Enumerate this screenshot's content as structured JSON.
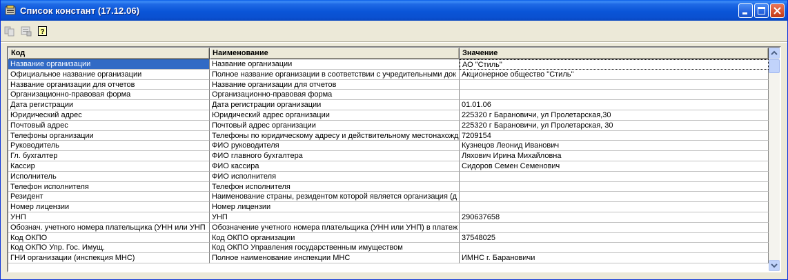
{
  "window": {
    "title": "Список констант (17.12.06)"
  },
  "colors": {
    "title_bar": "#0a55d8",
    "selection": "#316ac5",
    "window_bg": "#ece9d8"
  },
  "toolbar": {
    "icons": [
      "copy-icon",
      "properties-icon",
      "help-icon"
    ]
  },
  "grid": {
    "columns": [
      "Код",
      "Наименование",
      "Значение"
    ],
    "rows": [
      {
        "code": "Название организации",
        "name": "Название организации",
        "value": " АО \"Стиль\""
      },
      {
        "code": "Официальное название организации",
        "name": "Полное название организации в соответствии с учредительными док",
        "value": "Акционерное общество \"Стиль\""
      },
      {
        "code": "Название организации для отчетов",
        "name": "Название организации для отчетов",
        "value": ""
      },
      {
        "code": "Организационно-правовая форма",
        "name": "Организационно-правовая форма",
        "value": ""
      },
      {
        "code": "Дата регистрации",
        "name": "Дата регистрации организации",
        "value": "01.01.06"
      },
      {
        "code": "Юридический адрес",
        "name": "Юридический адрес организации",
        "value": "225320 г Барановичи, ул Пролетарская,30"
      },
      {
        "code": "Почтовый адрес",
        "name": "Почтовый адрес организации",
        "value": "225320 г Барановичи, ул Пролетарская, 30"
      },
      {
        "code": "Телефоны организации",
        "name": "Телефоны по юридическому адресу и действительному местонахожд",
        "value": "7209154"
      },
      {
        "code": "Руководитель",
        "name": "ФИО руководителя",
        "value": "Кузнецов Леонид Иванович"
      },
      {
        "code": "Гл. бухгалтер",
        "name": "ФИО главного бухгалтера",
        "value": "Ляхович Ирина Михайловна"
      },
      {
        "code": "Кассир",
        "name": "ФИО кассира",
        "value": "Сидоров Семен Семенович"
      },
      {
        "code": "Исполнитель",
        "name": "ФИО исполнителя",
        "value": ""
      },
      {
        "code": "Телефон исполнителя",
        "name": "Телефон исполнителя",
        "value": ""
      },
      {
        "code": "Резидент",
        "name": "Наименование страны, резидентом которой является организация (д",
        "value": ""
      },
      {
        "code": "Номер лицензии",
        "name": "Номер лицензии",
        "value": ""
      },
      {
        "code": "УНП",
        "name": "УНП",
        "value": "290637658"
      },
      {
        "code": "Обознач. учетного номера плательщика (УНН или УНП",
        "name": "Обозначение учетного номера плательщика (УНН или УНП) в платеж",
        "value": ""
      },
      {
        "code": "Код ОКПО",
        "name": "Код ОКПО организации",
        "value": "37548025"
      },
      {
        "code": "Код ОКПО Упр. Гос. Имущ.",
        "name": "Код ОКПО Управления государственным имуществом",
        "value": ""
      },
      {
        "code": "ГНИ организации (инспекция МНС)",
        "name": "Полное наименование инспекции МНС",
        "value": "ИМНС г. Барановичи"
      }
    ]
  }
}
